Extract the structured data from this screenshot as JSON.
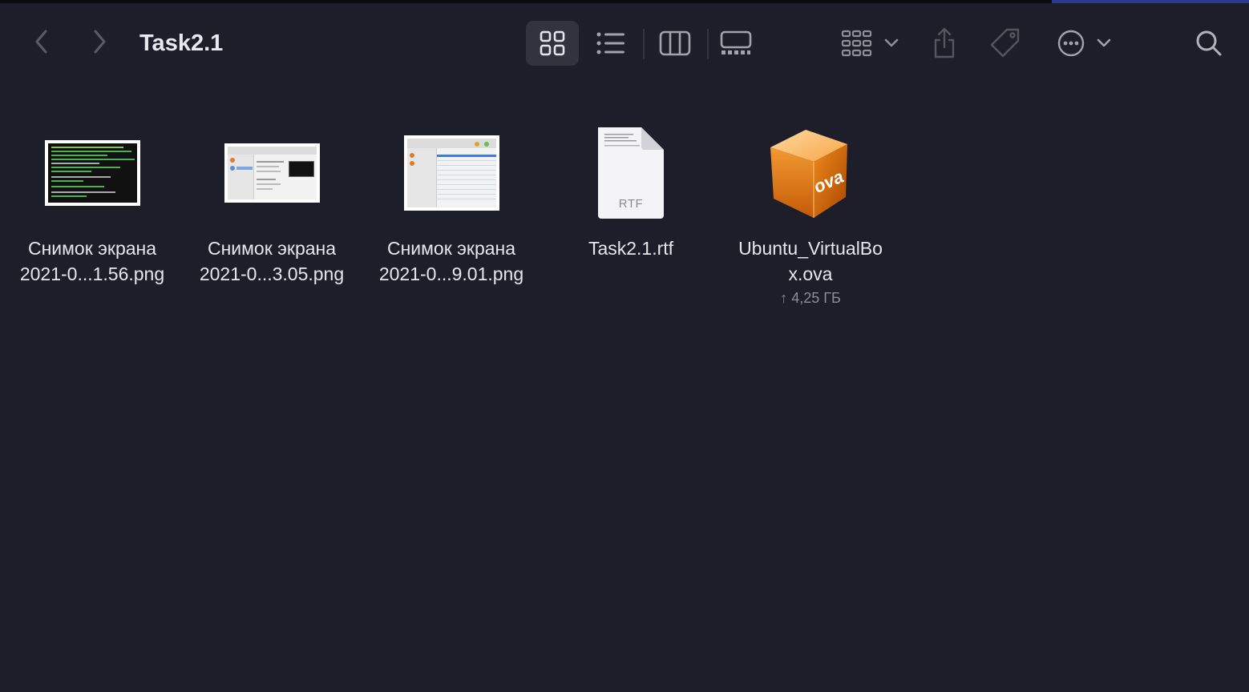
{
  "window": {
    "title": "Task2.1"
  },
  "toolbar": {
    "back_icon": "chevron-left-icon",
    "forward_icon": "chevron-right-icon",
    "views": [
      "icon-view-icon",
      "list-view-icon",
      "column-view-icon",
      "gallery-view-icon"
    ],
    "active_view": "icon-view-icon",
    "group_icon": "group-by-icon",
    "share_icon": "share-icon",
    "tag_icon": "tag-icon",
    "more_icon": "more-actions-icon",
    "search_icon": "search-icon"
  },
  "files": [
    {
      "line1": "Снимок экрана",
      "line2": "2021-0...1.56.png",
      "kind": "png-terminal"
    },
    {
      "line1": "Снимок экрана",
      "line2": "2021-0...3.05.png",
      "kind": "png-virtualbox"
    },
    {
      "line1": "Снимок экрана",
      "line2": "2021-0...9.01.png",
      "kind": "png-virtualbox-list"
    },
    {
      "line1": "Task2.1.rtf",
      "line2": "",
      "kind": "rtf",
      "badge": "RTF"
    },
    {
      "line1": "Ubuntu_VirtualBo",
      "line2": "x.ova",
      "kind": "ova",
      "badge": "ova",
      "status": "↑ 4,25 ГБ"
    }
  ],
  "colors": {
    "background": "#1e1e2a",
    "text": "#e6e6ec",
    "muted": "#8c8c96",
    "ova_orange": "#f08a1c"
  }
}
